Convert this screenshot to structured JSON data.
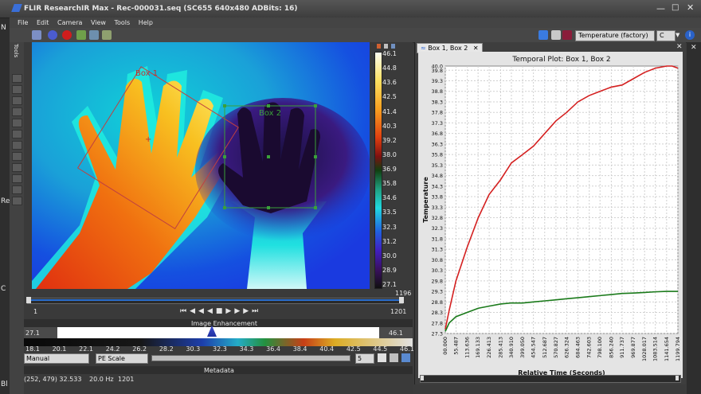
{
  "window": {
    "title": "FLIR ResearchIR Max - Rec-000031.seq (SC655 640x480 ADBits: 16)"
  },
  "menu": [
    "File",
    "Edit",
    "Camera",
    "View",
    "Tools",
    "Help"
  ],
  "toolbar": {
    "measure_mode": "Temperature (factory)",
    "unit": "C"
  },
  "side_panel": {
    "label": "Tools"
  },
  "gutter_letters": [
    "N",
    "Re",
    "C",
    "Bl"
  ],
  "image": {
    "box1_label": "Box 1",
    "box2_label": "Box 2",
    "colorbar_labels": [
      "46.1",
      "44.8",
      "43.6",
      "42.5",
      "41.4",
      "40.3",
      "39.2",
      "38.0",
      "36.9",
      "35.8",
      "34.6",
      "33.5",
      "32.3",
      "31.2",
      "30.0",
      "28.9",
      "27.1"
    ]
  },
  "timeline": {
    "start": "1",
    "end": "1201",
    "current": "1196"
  },
  "enhancement": {
    "title": "Image Enhancement",
    "min": "27.1",
    "max": "46.1",
    "ticks": [
      "18.1",
      "20.1",
      "22.1",
      "24.2",
      "26.2",
      "28.2",
      "30.3",
      "32.3",
      "34.3",
      "36.4",
      "38.4",
      "40.4",
      "42.5",
      "44.5",
      "46.1"
    ],
    "mode": "Manual",
    "scale": "PE Scale",
    "step": "5"
  },
  "metadata": {
    "title": "Metadata",
    "coords": "(252, 479) 32.533",
    "fps": "20.0 Hz",
    "frame": "1201"
  },
  "plot_tab": {
    "label": "Box 1, Box 2"
  },
  "chart_data": {
    "type": "line",
    "title": "Temporal Plot: Box 1, Box 2",
    "xlabel": "Relative Time (Seconds)",
    "ylabel": "Temperature",
    "ylim": [
      27.3,
      40.0
    ],
    "yticks": [
      27.3,
      27.8,
      28.3,
      28.8,
      29.3,
      29.8,
      30.3,
      30.8,
      31.3,
      31.8,
      32.3,
      32.8,
      33.3,
      33.8,
      34.3,
      34.8,
      35.3,
      35.8,
      36.3,
      36.8,
      37.3,
      37.8,
      38.3,
      38.8,
      39.3,
      39.8
    ],
    "yticklabels": [
      "27.3",
      "27.8",
      "28.3",
      "28.8",
      "29.3",
      "29.8",
      "30.3",
      "30.8",
      "31.3",
      "31.8",
      "32.3",
      "32.8",
      "33.3",
      "33.8",
      "34.3",
      "34.8",
      "35.3",
      "35.8",
      "36.3",
      "36.8",
      "37.3",
      "37.8",
      "38.3",
      "38.8",
      "39.3",
      "39.8"
    ],
    "ytop_label": "40.0",
    "xlim": [
      0,
      1199.794
    ],
    "xticks": [
      0,
      55.487,
      113.636,
      169.133,
      226.413,
      285.413,
      340.91,
      399.05,
      454.547,
      512.687,
      570.827,
      626.324,
      684.463,
      742.603,
      798.1,
      856.24,
      911.737,
      969.877,
      1028.017,
      1083.514,
      1141.654,
      1199.794
    ],
    "xticklabels": [
      "00.000",
      "55.487",
      "113.636",
      "169.133",
      "226.413",
      "285.413",
      "340.910",
      "399.050",
      "454.547",
      "512.687",
      "570.827",
      "626.324",
      "684.463",
      "742.603",
      "798.100",
      "856.240",
      "911.737",
      "969.877",
      "1028.017",
      "1083.514",
      "1141.654",
      "1199.794"
    ],
    "series": [
      {
        "color": "#d42020",
        "x": [
          0,
          20,
          55,
          113,
          170,
          226,
          285,
          341,
          399,
          455,
          513,
          571,
          626,
          684,
          742,
          798,
          856,
          912,
          970,
          1028,
          1084,
          1142,
          1170,
          1199.794
        ],
        "values": [
          27.5,
          28.4,
          29.8,
          31.4,
          32.8,
          33.9,
          34.6,
          35.4,
          35.8,
          36.2,
          36.8,
          37.4,
          37.8,
          38.3,
          38.6,
          38.8,
          39.0,
          39.1,
          39.4,
          39.7,
          39.9,
          40.0,
          40.0,
          39.9
        ]
      },
      {
        "color": "#1a7a1a",
        "x": [
          0,
          20,
          55,
          113,
          170,
          226,
          285,
          341,
          399,
          455,
          513,
          571,
          626,
          684,
          742,
          798,
          856,
          912,
          970,
          1028,
          1084,
          1142,
          1199.794
        ],
        "values": [
          27.4,
          27.8,
          28.1,
          28.3,
          28.5,
          28.6,
          28.7,
          28.75,
          28.75,
          28.8,
          28.85,
          28.9,
          28.95,
          29.0,
          29.05,
          29.1,
          29.15,
          29.2,
          29.22,
          29.25,
          29.28,
          29.3,
          29.3
        ]
      }
    ]
  }
}
